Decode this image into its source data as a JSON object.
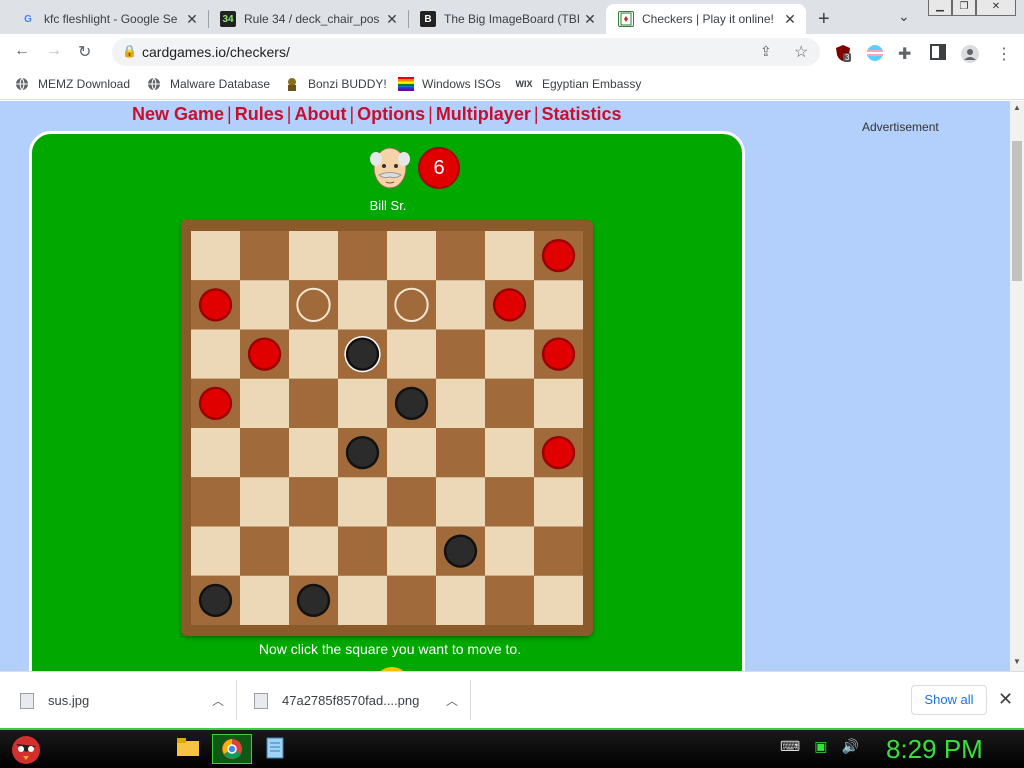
{
  "tabs": [
    {
      "title": "kfc fleshlight - Google Se",
      "favicon": "G"
    },
    {
      "title": "Rule 34 / deck_chair_pos",
      "favicon": "34"
    },
    {
      "title": "The Big ImageBoard (TBI",
      "favicon": "B"
    },
    {
      "title": "Checkers | Play it online!",
      "favicon": "card",
      "active": true
    }
  ],
  "toolbar": {
    "url": "cardgames.io/checkers/"
  },
  "extensions": {
    "badge_count": "3"
  },
  "bookmarks": [
    {
      "label": "MEMZ Download",
      "icon": "globe-icon"
    },
    {
      "label": "Malware Database",
      "icon": "globe-icon"
    },
    {
      "label": "Bonzi BUDDY!",
      "icon": "bonzi-icon"
    },
    {
      "label": "Windows ISOs",
      "icon": "windows-icon"
    },
    {
      "label": "Egyptian Embassy",
      "icon": "wix-icon",
      "icon_text": "WIX"
    }
  ],
  "page": {
    "menu": [
      "New Game",
      "Rules",
      "About",
      "Options",
      "Multiplayer",
      "Statistics"
    ],
    "advertisement": "Advertisement",
    "opponent": {
      "name": "Bill Sr.",
      "score": "6"
    },
    "status": "Now click the square you want to move to.",
    "board": {
      "size": 8,
      "light_color": "#ecd7b6",
      "dark_color": "#a06a3a",
      "pieces": [
        {
          "row": 0,
          "col": 7,
          "color": "red"
        },
        {
          "row": 1,
          "col": 0,
          "color": "red"
        },
        {
          "row": 1,
          "col": 6,
          "color": "red"
        },
        {
          "row": 2,
          "col": 1,
          "color": "red"
        },
        {
          "row": 2,
          "col": 7,
          "color": "red"
        },
        {
          "row": 3,
          "col": 0,
          "color": "red"
        },
        {
          "row": 4,
          "col": 7,
          "color": "red"
        },
        {
          "row": 2,
          "col": 3,
          "color": "black",
          "selected": true
        },
        {
          "row": 3,
          "col": 4,
          "color": "black"
        },
        {
          "row": 4,
          "col": 3,
          "color": "black"
        },
        {
          "row": 6,
          "col": 5,
          "color": "black"
        },
        {
          "row": 7,
          "col": 0,
          "color": "black"
        },
        {
          "row": 7,
          "col": 2,
          "color": "black"
        }
      ],
      "move_hints": [
        {
          "row": 1,
          "col": 2
        },
        {
          "row": 1,
          "col": 4
        }
      ]
    }
  },
  "downloads": [
    {
      "filename": "sus.jpg"
    },
    {
      "filename": "47a2785f8570fad....png"
    }
  ],
  "show_all": "Show all",
  "taskbar": {
    "clock": "8:29 PM"
  },
  "colors": {
    "accent_red": "#c8102e",
    "felt_green": "#00a800",
    "page_blue": "#b2d0fb"
  }
}
